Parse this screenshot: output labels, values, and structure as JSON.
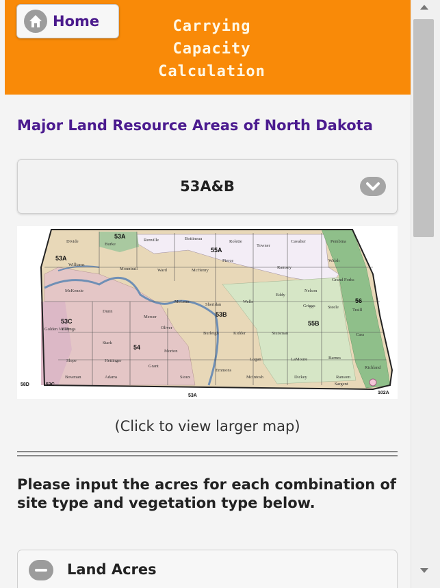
{
  "header": {
    "home_label": "Home",
    "title_lines": [
      "Carrying",
      "Capacity",
      "Calculation"
    ],
    "bg_color": "#f98a08"
  },
  "section": {
    "title": "Major Land Resource Areas of North Dakota"
  },
  "mlra_select": {
    "selected": "53A&B",
    "icon": "chevron-down-icon"
  },
  "map": {
    "caption": "(Click to view larger map)",
    "region_labels": [
      "53A",
      "55A",
      "53A",
      "53B",
      "55B",
      "56",
      "53C",
      "54",
      "58D",
      "53C",
      "102A",
      "53A"
    ],
    "county_labels": [
      "Divide",
      "Burke",
      "Renville",
      "Bottineau",
      "Rolette",
      "Towner",
      "Cavalier",
      "Pembina",
      "Williams",
      "Mountrail",
      "Ward",
      "McHenry",
      "Pierce",
      "Ramsey",
      "Walsh",
      "McKenzie",
      "Dunn",
      "Mercer",
      "McLean",
      "Sheridan",
      "Wells",
      "Eddy",
      "Nelson",
      "Grand Forks",
      "Traill",
      "Golden Valley",
      "Billings",
      "Stark",
      "Morton",
      "Oliver",
      "Burleigh",
      "Kidder",
      "Stutsman",
      "Griggs",
      "Steele",
      "Cass",
      "Slope",
      "Hettinger",
      "Grant",
      "Emmons",
      "Logan",
      "LaMoure",
      "Barnes",
      "Ransom",
      "Richland",
      "Bowman",
      "Adams",
      "Sioux",
      "McIntosh",
      "Dickey",
      "Sargent"
    ]
  },
  "instructions": "Please input the acres for each combination of site type and vegetation type below.",
  "collapsible": {
    "label": "Land Acres",
    "icon": "minus-icon"
  }
}
